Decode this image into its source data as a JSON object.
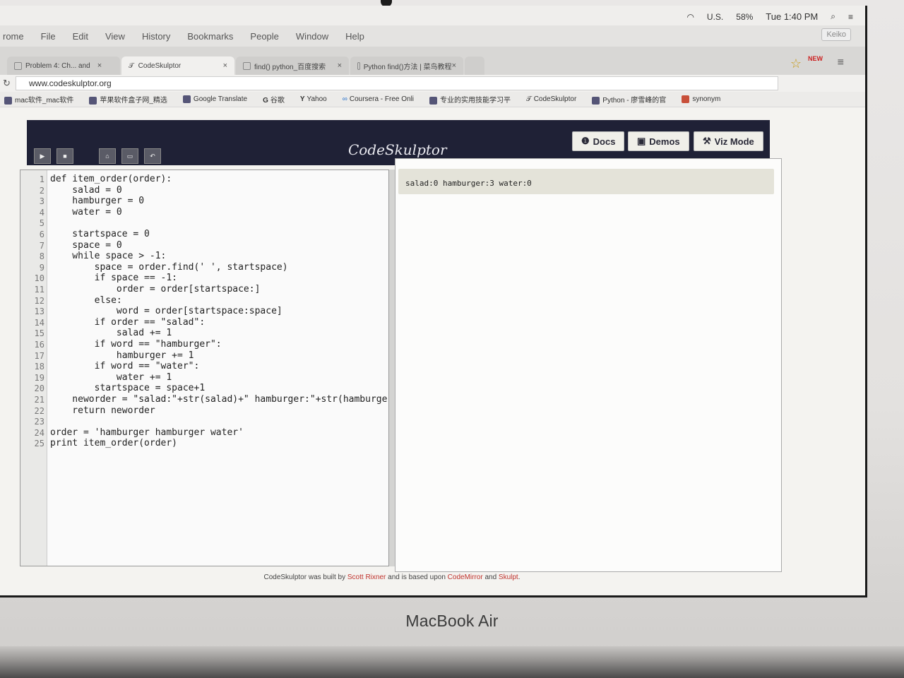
{
  "hardware": {
    "brand": "MacBook Air"
  },
  "menubar": {
    "input_source": "U.S.",
    "battery": "58%",
    "clock": "Tue 1:40 PM"
  },
  "app_menu": {
    "items": [
      "rome",
      "File",
      "Edit",
      "View",
      "History",
      "Bookmarks",
      "People",
      "Window",
      "Help"
    ],
    "user": "Keiko"
  },
  "tabs": [
    {
      "label": "Problem 4: Ch... and",
      "active": false
    },
    {
      "label": "CodeSkulptor",
      "active": true
    },
    {
      "label": "find() python_百度搜索",
      "active": false
    },
    {
      "label": "Python find()方法 | 菜鸟教程",
      "active": false
    }
  ],
  "address": {
    "url": "www.codeskulptor.org"
  },
  "bookmarks": [
    "mac软件_mac软件",
    "苹果软件盒子网_精选",
    "Google Translate",
    "谷歌",
    "Yahoo",
    "Coursera - Free Onli",
    "专业的实用技能学习平",
    "CodeSkulptor",
    "Python - 廖雪峰的官",
    "synonym"
  ],
  "header": {
    "title": "CodeSkulptor",
    "docs_label": "Docs",
    "demos_label": "Demos",
    "viz_label": "Viz Mode"
  },
  "editor": {
    "lines": [
      "def item_order(order):",
      "    salad = 0",
      "    hamburger = 0",
      "    water = 0",
      "",
      "    startspace = 0",
      "    space = 0",
      "    while space > -1:",
      "        space = order.find(' ', startspace)",
      "        if space == -1:",
      "            order = order[startspace:]",
      "        else:",
      "            word = order[startspace:space]",
      "        if order == \"salad\":",
      "            salad += 1",
      "        if word == \"hamburger\":",
      "            hamburger += 1",
      "        if word == \"water\":",
      "            water += 1",
      "        startspace = space+1",
      "    neworder = \"salad:\"+str(salad)+\" hamburger:\"+str(hamburger",
      "    return neworder",
      "",
      "order = 'hamburger hamburger water'",
      "print item_order(order)"
    ]
  },
  "output": {
    "text": "salad:0 hamburger:3 water:0"
  },
  "footer": {
    "prefix": "CodeSkulptor was built by",
    "author": "Scott Rixner",
    "mid": "and is based upon",
    "lib1": "CodeMirror",
    "and": "and",
    "lib2": "Skulpt",
    "end": "."
  }
}
